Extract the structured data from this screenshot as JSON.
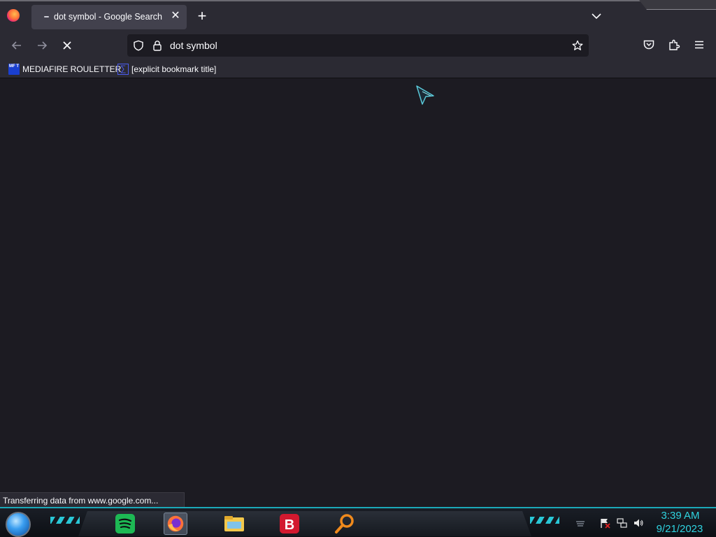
{
  "tab": {
    "title": "dot symbol - Google Search",
    "close_glyph": "✕"
  },
  "new_tab_glyph": "+",
  "urlbar": {
    "text": "dot symbol"
  },
  "bookmarks": [
    {
      "label": "MEDIAFIRE ROULETTER",
      "icon_text": "MF T",
      "icon": "mediafire-icon"
    },
    {
      "label": "[explicit bookmark title]",
      "icon": "sigma-icon"
    }
  ],
  "status": {
    "text": "Transferring data from www.google.com..."
  },
  "taskbar": {
    "apps": [
      {
        "name": "spotify",
        "color": "#1db954"
      },
      {
        "name": "firefox",
        "color": "#ff7139"
      },
      {
        "name": "file-explorer",
        "color": "#f3c84b"
      },
      {
        "name": "bitdefender",
        "color": "#d3192f",
        "letter": "B"
      },
      {
        "name": "search",
        "color": "#f08a1c"
      }
    ],
    "clock_time": "3:39 AM",
    "clock_date": "9/21/2023"
  },
  "colors": {
    "accent": "#2fd3e0",
    "chrome": "#2b2a33",
    "content_bg": "#1c1b22"
  }
}
